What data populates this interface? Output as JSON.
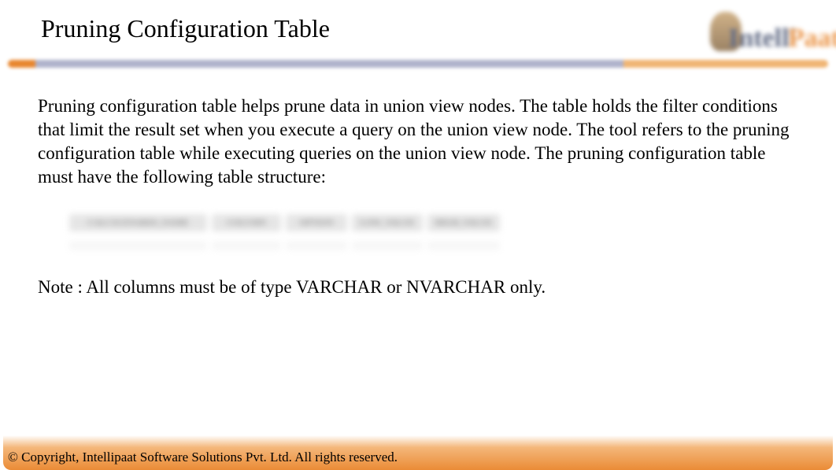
{
  "header": {
    "title": "Pruning Configuration Table",
    "logo_text_1": "Intelli",
    "logo_text_2": "Paat"
  },
  "body": {
    "paragraph": "Pruning configuration table helps prune data in union view nodes. The table holds the filter conditions that limit the result set when you execute a query on the union view node. The tool refers to the pruning configuration table while executing queries on the union view node. The pruning configuration table must have the following table structure:",
    "table_columns": [
      "CALCSCENARIO_NAME",
      "COLUMN",
      "OPTION",
      "LOW_VALUE",
      "HIGH_VALUE"
    ],
    "note": "Note : All columns must be of type VARCHAR or NVARCHAR only."
  },
  "footer": {
    "copyright": "© Copyright, Intellipaat Software Solutions Pvt. Ltd. All rights reserved."
  }
}
